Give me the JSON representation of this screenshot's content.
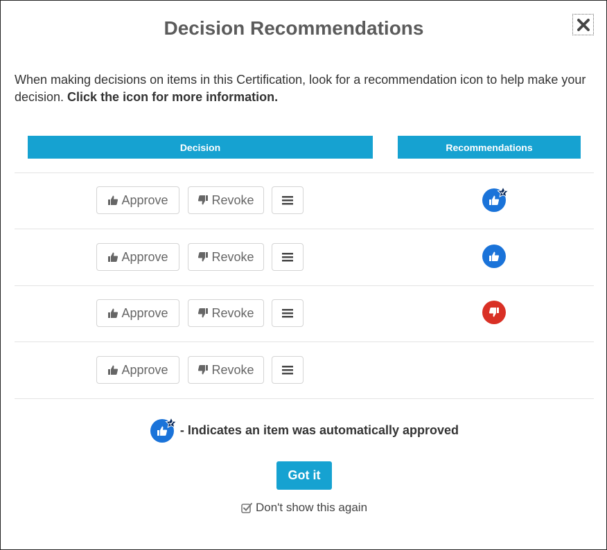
{
  "dialog": {
    "title": "Decision Recommendations",
    "intro_text": "When making decisions on items in this Certification, look for a recommendation icon to help make your decision. ",
    "intro_bold": "Click the icon for more information.",
    "close_icon": "close-icon"
  },
  "table": {
    "headers": {
      "decision": "Decision",
      "recommendations": "Recommendations"
    },
    "rows": [
      {
        "approve": "Approve",
        "revoke": "Revoke",
        "recommendation": "auto-approved-thumbs-up"
      },
      {
        "approve": "Approve",
        "revoke": "Revoke",
        "recommendation": "thumbs-up"
      },
      {
        "approve": "Approve",
        "revoke": "Revoke",
        "recommendation": "thumbs-down"
      },
      {
        "approve": "Approve",
        "revoke": "Revoke",
        "recommendation": ""
      }
    ]
  },
  "legend": {
    "text": "- Indicates an item was automatically approved"
  },
  "actions": {
    "got_it": "Got it",
    "dont_show": "Don't show this again",
    "dont_show_checked": true
  },
  "colors": {
    "accent": "#16a2d1",
    "approve_blue": "#1a73d9",
    "revoke_red": "#d93025",
    "badge_navy": "#0b2a5b"
  }
}
